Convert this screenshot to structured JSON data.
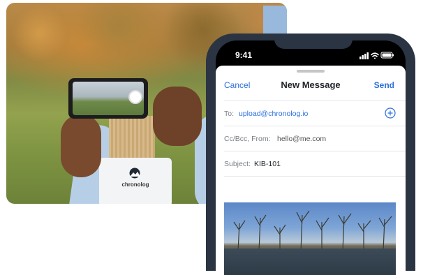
{
  "status_bar": {
    "time": "9:41"
  },
  "compose": {
    "cancel_label": "Cancel",
    "title": "New Message",
    "send_label": "Send",
    "to_label": "To:",
    "to_value": "upload@chronolog.io",
    "cc_label": "Cc/Bcc, From:",
    "cc_value": "hello@me.com",
    "subject_label": "Subject:",
    "subject_value": "KIB-101"
  },
  "device": {
    "brand": "chronolog"
  },
  "colors": {
    "accent": "#2a6fdb",
    "phone_frame": "#2b3442"
  },
  "icons": [
    "signal-icon",
    "wifi-icon",
    "battery-icon",
    "add-contact-icon",
    "chronolog-logo-icon"
  ]
}
